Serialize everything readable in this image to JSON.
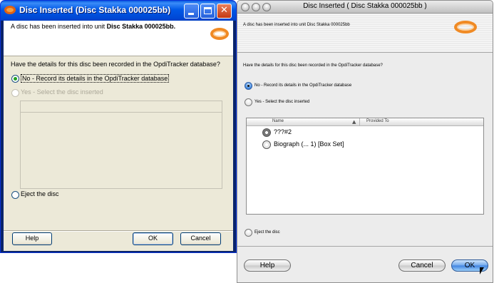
{
  "xp_dialog": {
    "title": "Disc Inserted (Disc Stakka 000025bb)",
    "message_prefix": "A disc has been inserted into unit ",
    "message_unit": "Disc Stakka 000025bb.",
    "question": "Have the details for this disc been recorded in the OpdiTracker database?",
    "option_no": "No - Record its details in the OpdiTracker database",
    "option_yes": "Yes - Select the disc inserted",
    "option_eject": "Eject the disc",
    "help_label": "Help",
    "ok_label": "OK",
    "cancel_label": "Cancel",
    "selected_option": "no"
  },
  "mac_dialog": {
    "title": "Disc Inserted ( Disc Stakka 000025bb )",
    "message": "A disc has been inserted into unit Disc Stakka 000025bb",
    "question": "Have the details for this disc been recorded in the OpdiTracker database?",
    "option_no": "No - Record its details in the OpdiTracker database",
    "option_yes": "Yes - Select the disc inserted",
    "option_eject": "Eject the disc",
    "columns": [
      "Name",
      "Provided To"
    ],
    "rows": [
      {
        "name": "???#2",
        "icon": "disc-icon"
      },
      {
        "name": "Biograph (... 1) [Box Set]",
        "icon": "disc-icon"
      }
    ],
    "help_label": "Help",
    "cancel_label": "Cancel",
    "ok_label": "OK",
    "selected_option": "no"
  },
  "colors": {
    "xp_titlebar": "#0058e6",
    "xp_face": "#ece9d8",
    "mac_face": "#ececec",
    "logo_orange": "#f08a24",
    "mac_default_button": "#3f82e0"
  }
}
